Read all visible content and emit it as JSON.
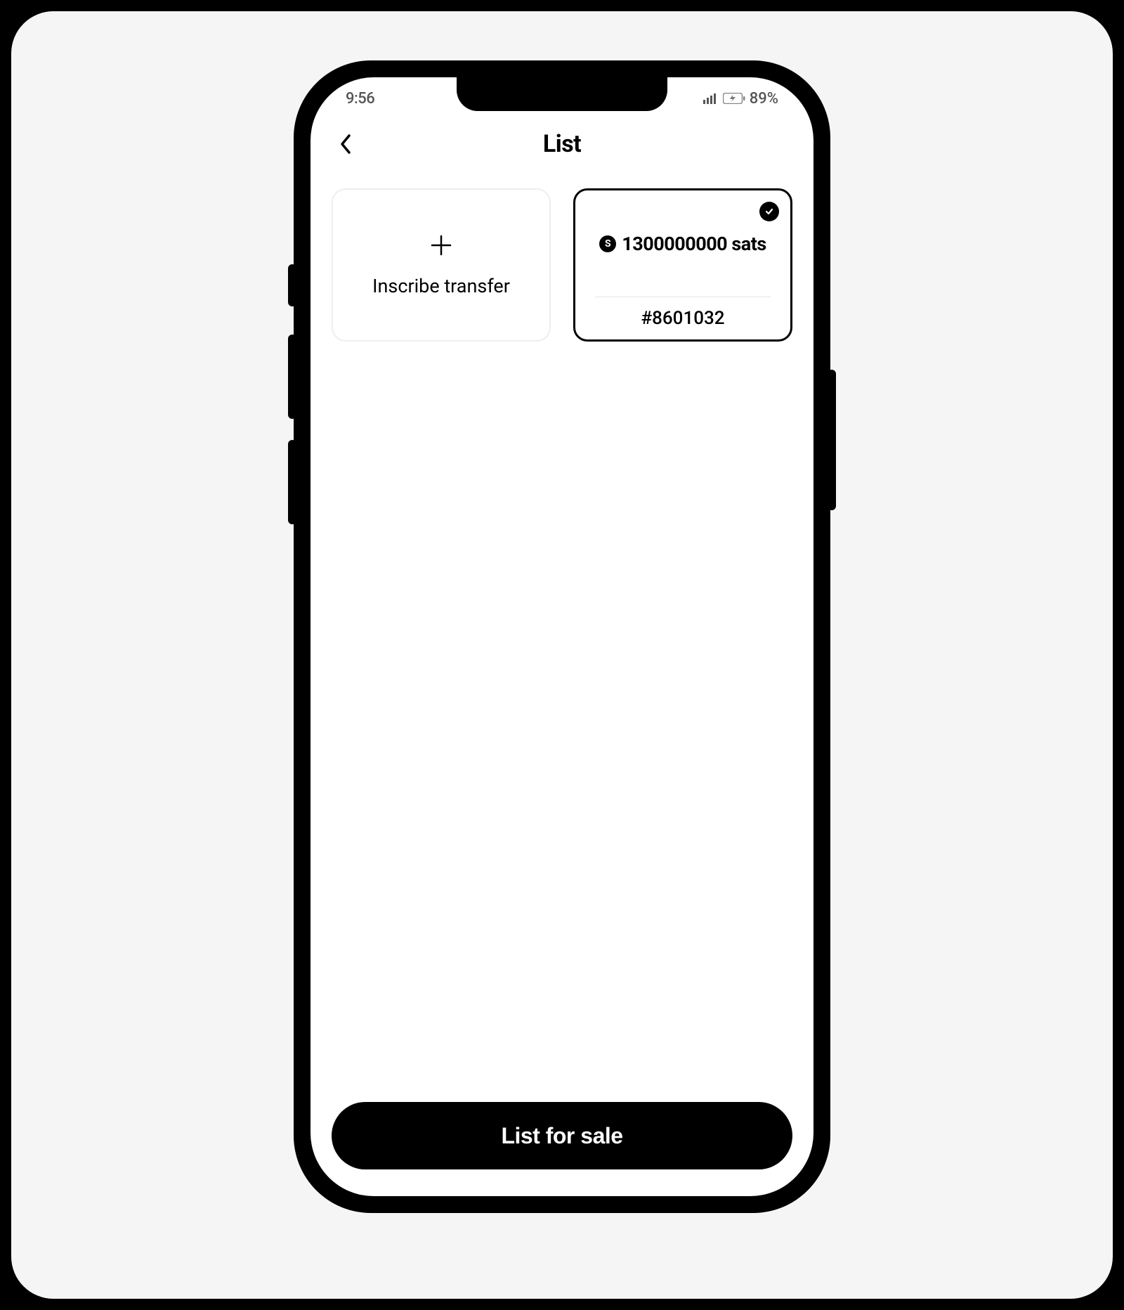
{
  "status_bar": {
    "time": "9:56",
    "battery_percent": "89%"
  },
  "header": {
    "title": "List"
  },
  "cards": {
    "inscribe_label": "Inscribe transfer",
    "sats_card": {
      "amount": "1300000000 sats",
      "id": "#8601032",
      "s_badge": "S",
      "selected": true
    }
  },
  "footer": {
    "button_label": "List for sale"
  }
}
